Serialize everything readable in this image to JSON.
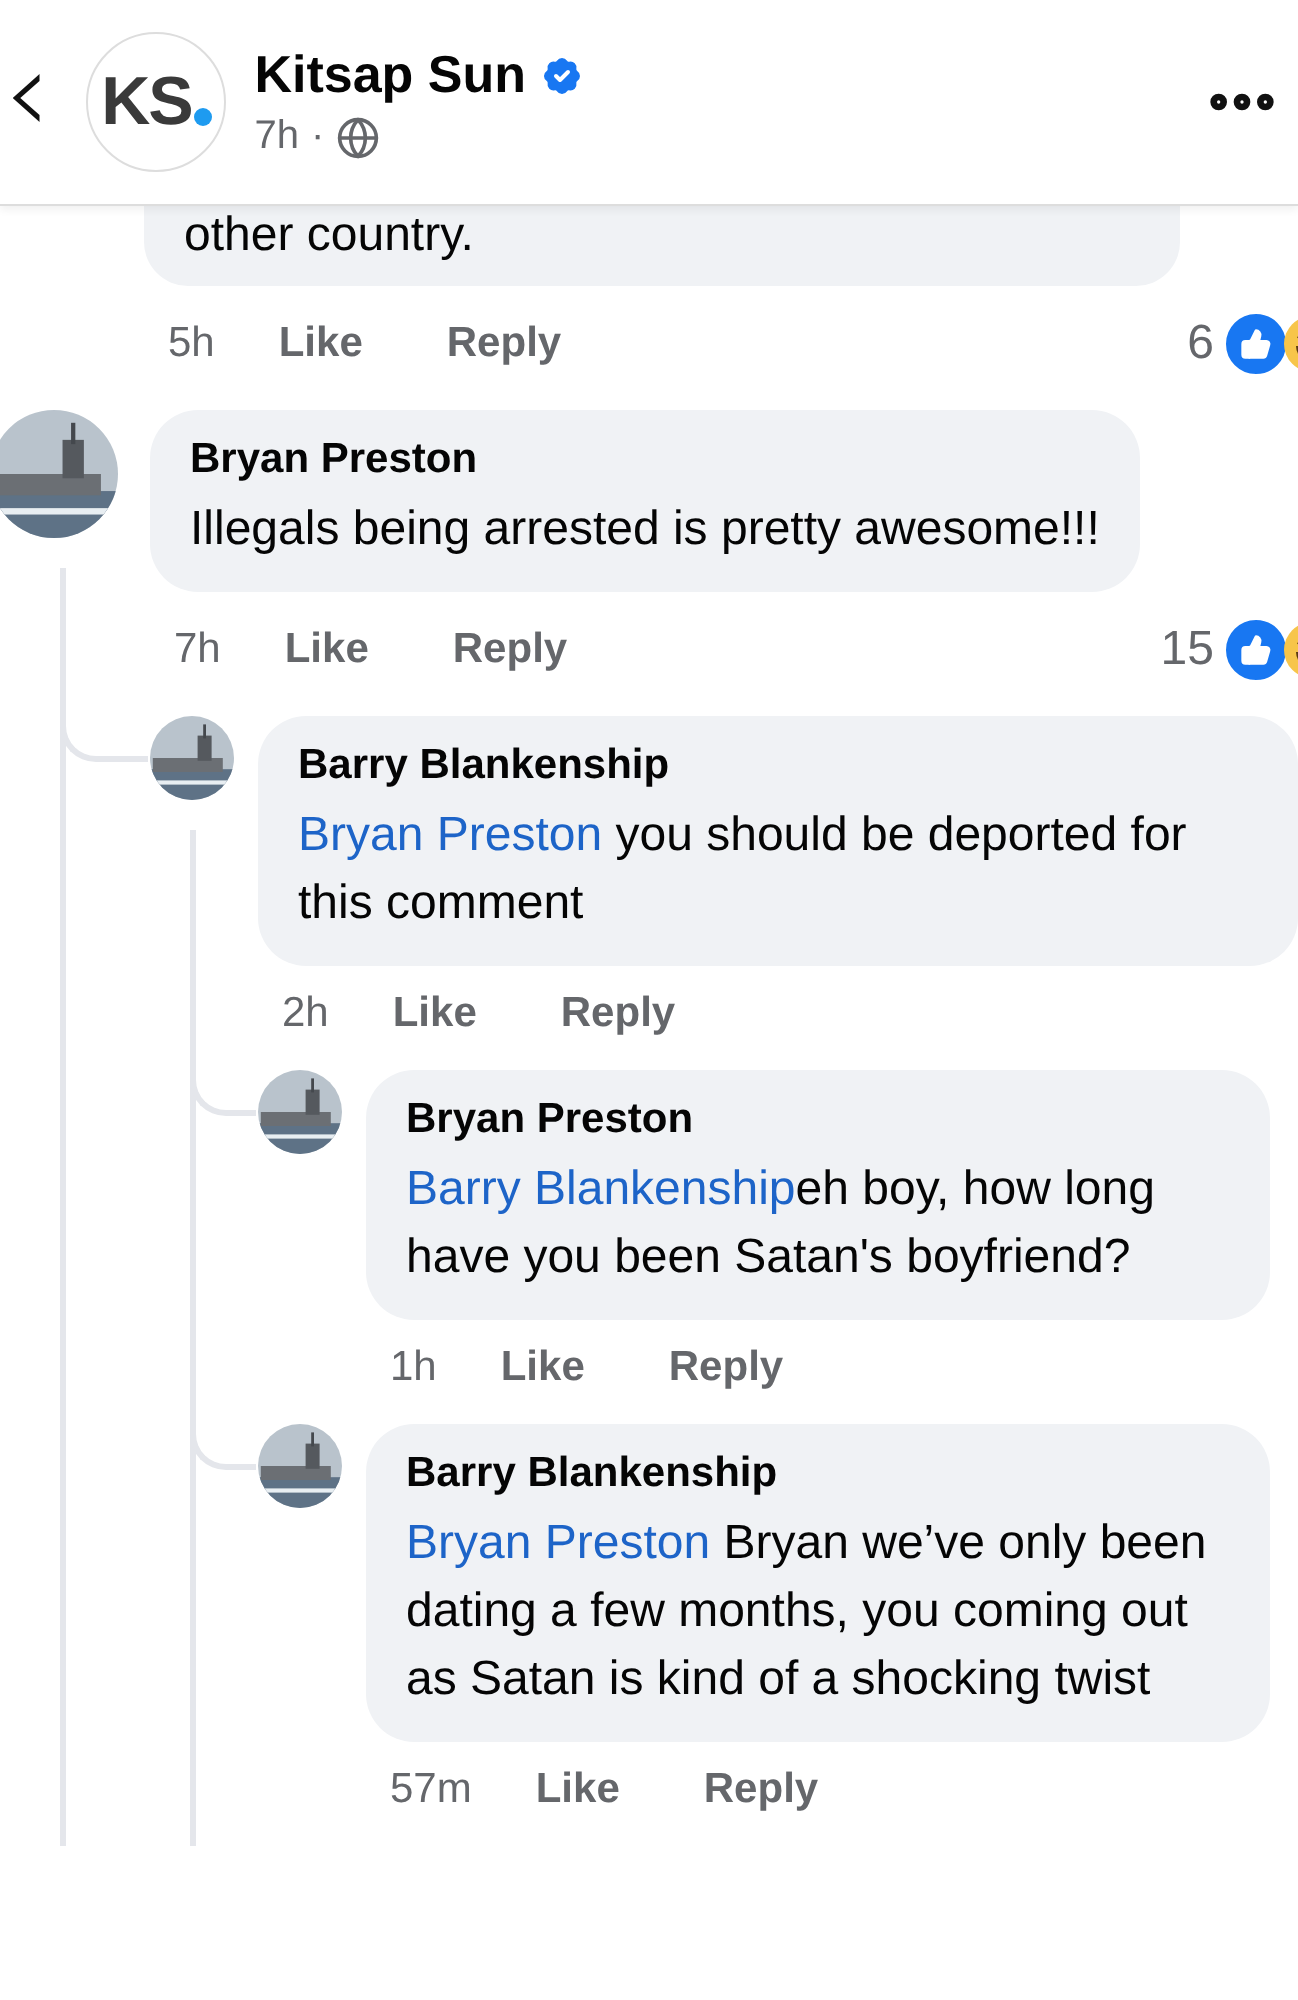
{
  "header": {
    "back": "‹",
    "logo": "KS",
    "title": "Kitsap Sun",
    "verified": true,
    "time": "7h",
    "separator": "·"
  },
  "partial_comment": {
    "text": "other country.",
    "time": "5h",
    "like": "Like",
    "reply": "Reply",
    "reactions": "6"
  },
  "comments": [
    {
      "name": "Bryan Preston",
      "text": "Illegals being arrested is pretty awesome!!!",
      "time": "7h",
      "like": "Like",
      "reply": "Reply",
      "reactions": "15",
      "children": [
        {
          "name": "Barry Blankenship",
          "mention": "Bryan Preston",
          "text": " you should be deported for this comment",
          "time": "2h",
          "like": "Like",
          "reply": "Reply",
          "children": [
            {
              "name": "Bryan Preston",
              "mention": "Barry Blankenship",
              "text": "eh boy, how long have you been Satan's boyfriend?",
              "time": "1h",
              "like": "Like",
              "reply": "Reply"
            },
            {
              "name": "Barry Blankenship",
              "mention": "Bryan Preston",
              "text": " Bryan we’ve only been dating a few months, you coming out as Satan is kind of a shocking twist",
              "time": "57m",
              "like": "Like",
              "reply": "Reply"
            }
          ]
        }
      ]
    }
  ]
}
